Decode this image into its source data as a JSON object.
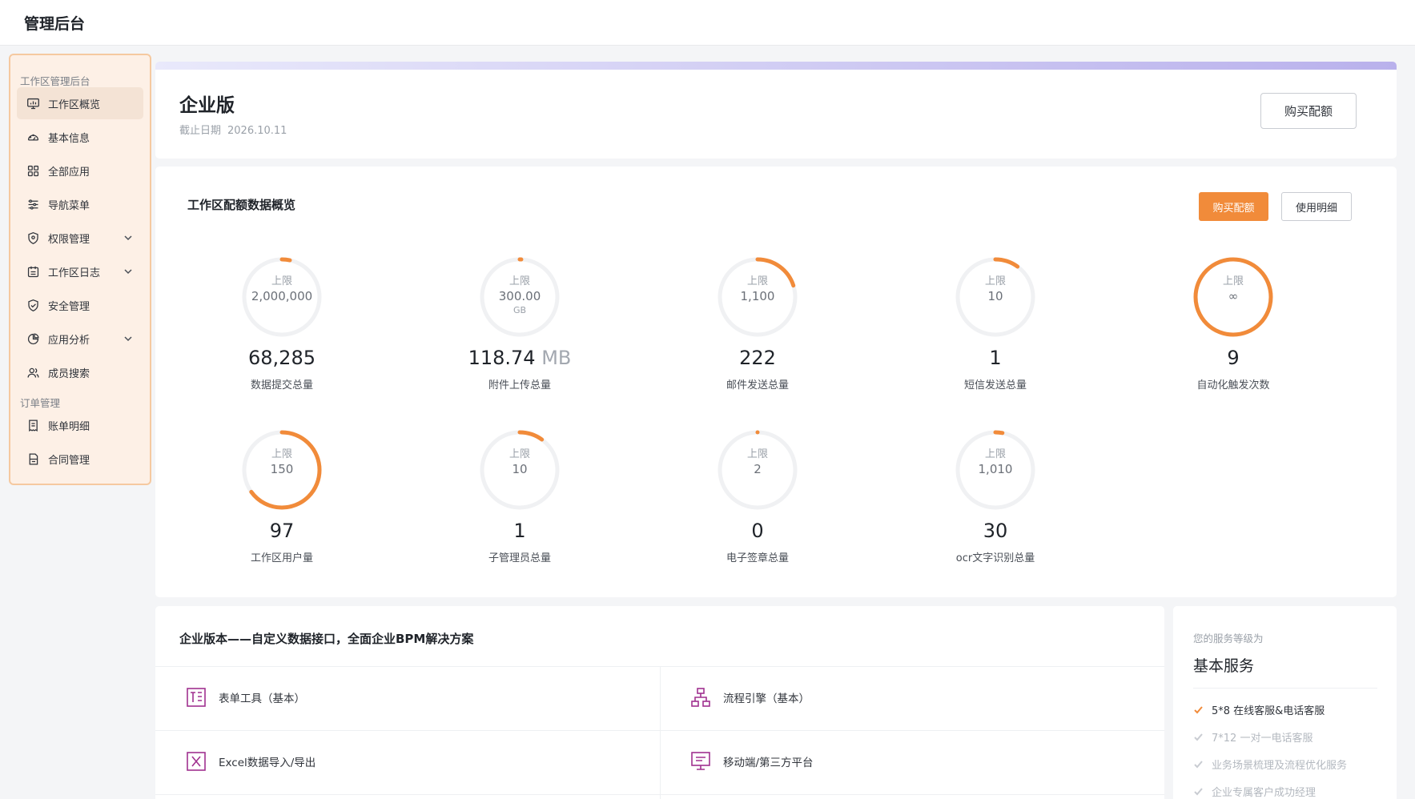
{
  "app": {
    "title": "管理后台"
  },
  "sidebar": {
    "groups": [
      {
        "label": "工作区管理后台"
      },
      {
        "label": "订单管理"
      }
    ],
    "items": [
      {
        "label": "工作区概览",
        "icon": "monitor-chart-icon",
        "active": true
      },
      {
        "label": "基本信息",
        "icon": "dashboard-gauge-icon"
      },
      {
        "label": "全部应用",
        "icon": "grid-apps-icon"
      },
      {
        "label": "导航菜单",
        "icon": "sliders-icon"
      },
      {
        "label": "权限管理",
        "icon": "shield-location-icon",
        "expandable": true
      },
      {
        "label": "工作区日志",
        "icon": "calendar-log-icon",
        "expandable": true
      },
      {
        "label": "安全管理",
        "icon": "shield-check-icon"
      },
      {
        "label": "应用分析",
        "icon": "pie-chart-icon",
        "expandable": true
      },
      {
        "label": "成员搜索",
        "icon": "users-icon"
      },
      {
        "label": "账单明细",
        "icon": "receipt-icon"
      },
      {
        "label": "合同管理",
        "icon": "contract-icon"
      }
    ]
  },
  "edition": {
    "title": "企业版",
    "date_label": "截止日期",
    "date_value": "2026.10.11",
    "buy_button": "购买配额"
  },
  "quota": {
    "title": "工作区配额数据概览",
    "buy_button": "购买配额",
    "detail_button": "使用明细",
    "limit_label": "上限",
    "accent": "#f18b3a",
    "track": "#f0f1f3",
    "items": [
      {
        "limit": "2,000,000",
        "value": "68,285",
        "label": "数据提交总量",
        "ratio": 0.034
      },
      {
        "limit": "300.00",
        "limit_unit": "GB",
        "value": "118.74",
        "value_unit": "MB",
        "label": "附件上传总量",
        "ratio": 0.006
      },
      {
        "limit": "1,100",
        "value": "222",
        "label": "邮件发送总量",
        "ratio": 0.2
      },
      {
        "limit": "10",
        "value": "1",
        "label": "短信发送总量",
        "ratio": 0.1
      },
      {
        "limit": "∞",
        "value": "9",
        "label": "自动化触发次数",
        "ratio": 1
      },
      {
        "limit": "150",
        "value": "97",
        "label": "工作区用户量",
        "ratio": 0.65
      },
      {
        "limit": "10",
        "value": "1",
        "label": "子管理员总量",
        "ratio": 0.1
      },
      {
        "limit": "2",
        "value": "0",
        "label": "电子签章总量",
        "ratio": 0
      },
      {
        "limit": "1,010",
        "value": "30",
        "label": "ocr文字识别总量",
        "ratio": 0.03
      }
    ]
  },
  "features": {
    "title": "企业版本——自定义数据接口，全面企业BPM解决方案",
    "items": [
      {
        "label": "表单工具（基本）",
        "icon": "form-tool-icon"
      },
      {
        "label": "流程引擎（基本）",
        "icon": "flow-engine-icon"
      },
      {
        "label": "Excel数据导入/导出",
        "icon": "excel-import-icon"
      },
      {
        "label": "移动端/第三方平台",
        "icon": "mobile-platform-icon"
      }
    ],
    "icon_color": "#a0318f"
  },
  "service": {
    "subtitle": "您的服务等级为",
    "title": "基本服务",
    "items": [
      {
        "label": "5*8 在线客服&电话客服",
        "enabled": true
      },
      {
        "label": "7*12 一对一电话客服",
        "enabled": false
      },
      {
        "label": "业务场景梳理及流程优化服务",
        "enabled": false
      },
      {
        "label": "企业专属客户成功经理",
        "enabled": false
      }
    ]
  }
}
